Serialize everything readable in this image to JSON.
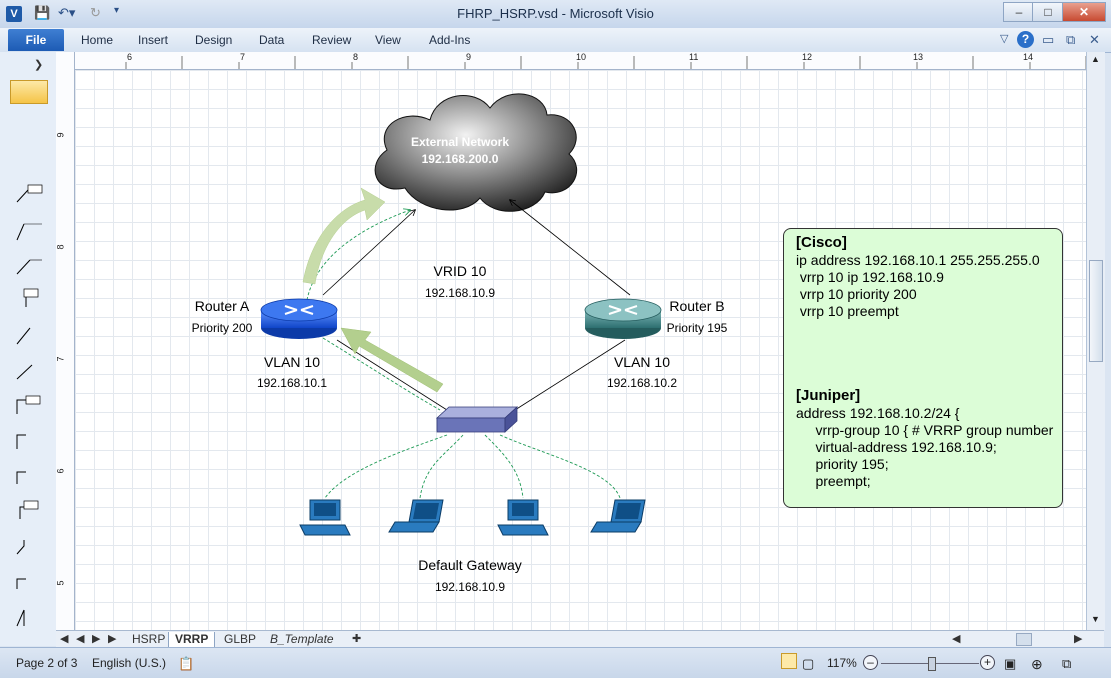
{
  "window": {
    "title": "FHRP_HSRP.vsd - Microsoft Visio",
    "app_icon": "V"
  },
  "ribbon": {
    "file": "File",
    "tabs": [
      "Home",
      "Insert",
      "Design",
      "Data",
      "Review",
      "View",
      "Add-Ins"
    ]
  },
  "ruler": {
    "h_marks": [
      "6",
      "7",
      "8",
      "9",
      "10",
      "11",
      "12",
      "13",
      "14"
    ],
    "v_marks": [
      "9",
      "8",
      "7",
      "6",
      "5"
    ]
  },
  "diagram": {
    "cloud_title": "External Network",
    "cloud_subnet": "192.168.200.0",
    "vrid_label": "VRID 10",
    "vrid_ip": "192.168.10.9",
    "router_a": {
      "name": "Router A",
      "priority": "Priority 200",
      "vlan": "VLAN 10",
      "ip": "192.168.10.1"
    },
    "router_b": {
      "name": "Router B",
      "priority": "Priority 195",
      "vlan": "VLAN 10",
      "ip": "192.168.10.2"
    },
    "gateway_label": "Default Gateway",
    "gateway_ip": "192.168.10.9"
  },
  "config_box": {
    "cisco_header": "[Cisco]",
    "cisco_lines": [
      "ip address 192.168.10.1 255.255.255.0",
      " vrrp 10 ip 192.168.10.9",
      " vrrp 10 priority 200",
      " vrrp 10 preempt"
    ],
    "juniper_header": "[Juniper]",
    "juniper_lines": [
      "address 192.168.10.2/24 {",
      "     vrrp-group 10 { # VRRP group number",
      "     virtual-address 192.168.10.9;",
      "     priority 195;",
      "     preempt;"
    ]
  },
  "page_tabs": [
    "HSRP",
    "VRRP",
    "GLBP",
    "B_Template"
  ],
  "active_tab": "VRRP",
  "status": {
    "page": "Page 2 of 3",
    "language": "English (U.S.)",
    "zoom": "117%"
  },
  "colors": {
    "cloud": "#555555",
    "router_a": "#1f5fe0",
    "router_b": "#3c8a8a",
    "switch": "#6a74b8",
    "config_bg": "#dcfdd7",
    "green_link": "#1e9a55"
  }
}
